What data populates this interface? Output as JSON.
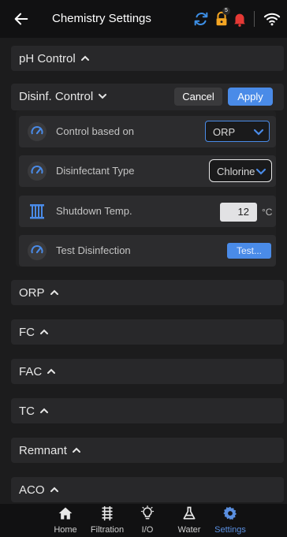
{
  "header": {
    "title": "Chemistry Settings",
    "notification_count": "5",
    "icons": [
      "back-arrow-icon",
      "sync-icon",
      "lock-icon",
      "bell-icon",
      "wifi-icon"
    ],
    "colors": {
      "sync": "#3d8fe6",
      "lock": "#f5a623",
      "bell": "#e53935"
    }
  },
  "sections": {
    "ph": "pH Control",
    "disinf": "Disinf. Control",
    "orp": "ORP",
    "fc": "FC",
    "fac": "FAC",
    "tc": "TC",
    "remnant": "Remnant",
    "aco": "ACO"
  },
  "actions": {
    "cancel": "Cancel",
    "apply": "Apply"
  },
  "disinf_rows": {
    "control_based_on": {
      "label": "Control based on",
      "value": "ORP"
    },
    "disinfectant_type": {
      "label": "Disinfectant Type",
      "value": "Chlorine"
    },
    "shutdown_temp": {
      "label": "Shutdown Temp.",
      "value": "12",
      "unit": "°C"
    },
    "test_disinfection": {
      "label": "Test Disinfection",
      "button": "Test..."
    }
  },
  "nav": {
    "home": "Home",
    "filtration": "Filtration",
    "io": "I/O",
    "water": "Water",
    "settings": "Settings",
    "active": "settings"
  },
  "accent_color": "#4a8be8"
}
